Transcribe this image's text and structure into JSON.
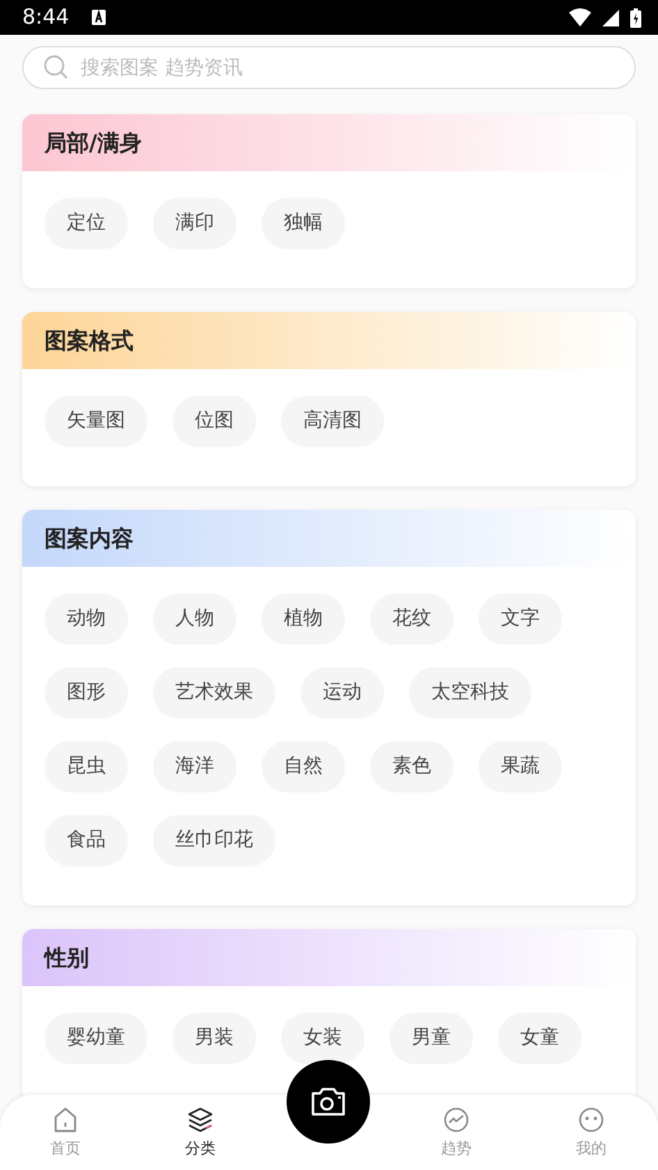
{
  "status_bar": {
    "time": "8:44"
  },
  "search": {
    "placeholder": "搜索图案 趋势资讯"
  },
  "sections": [
    {
      "title": "局部/满身",
      "color": "#fcc6d2",
      "tags": [
        "定位",
        "满印",
        "独幅"
      ]
    },
    {
      "title": "图案格式",
      "color": "#fdd597",
      "tags": [
        "矢量图",
        "位图",
        "高清图"
      ]
    },
    {
      "title": "图案内容",
      "color": "#c4d8fb",
      "tags": [
        "动物",
        "人物",
        "植物",
        "花纹",
        "文字",
        "图形",
        "艺术效果",
        "运动",
        "太空科技",
        "昆虫",
        "海洋",
        "自然",
        "素色",
        "果蔬",
        "食品",
        "丝巾印花"
      ]
    },
    {
      "title": "性别",
      "color": "#dbc4fa",
      "tags": [
        "婴幼童",
        "男装",
        "女装",
        "男童",
        "女童"
      ]
    }
  ],
  "bottom_nav": [
    {
      "kind": "home",
      "label": "首页",
      "selected": false
    },
    {
      "kind": "layers",
      "label": "分类",
      "selected": true
    },
    {
      "kind": "camera"
    },
    {
      "kind": "trend",
      "label": "趋势",
      "selected": false
    },
    {
      "kind": "face",
      "label": "我的",
      "selected": false
    }
  ]
}
